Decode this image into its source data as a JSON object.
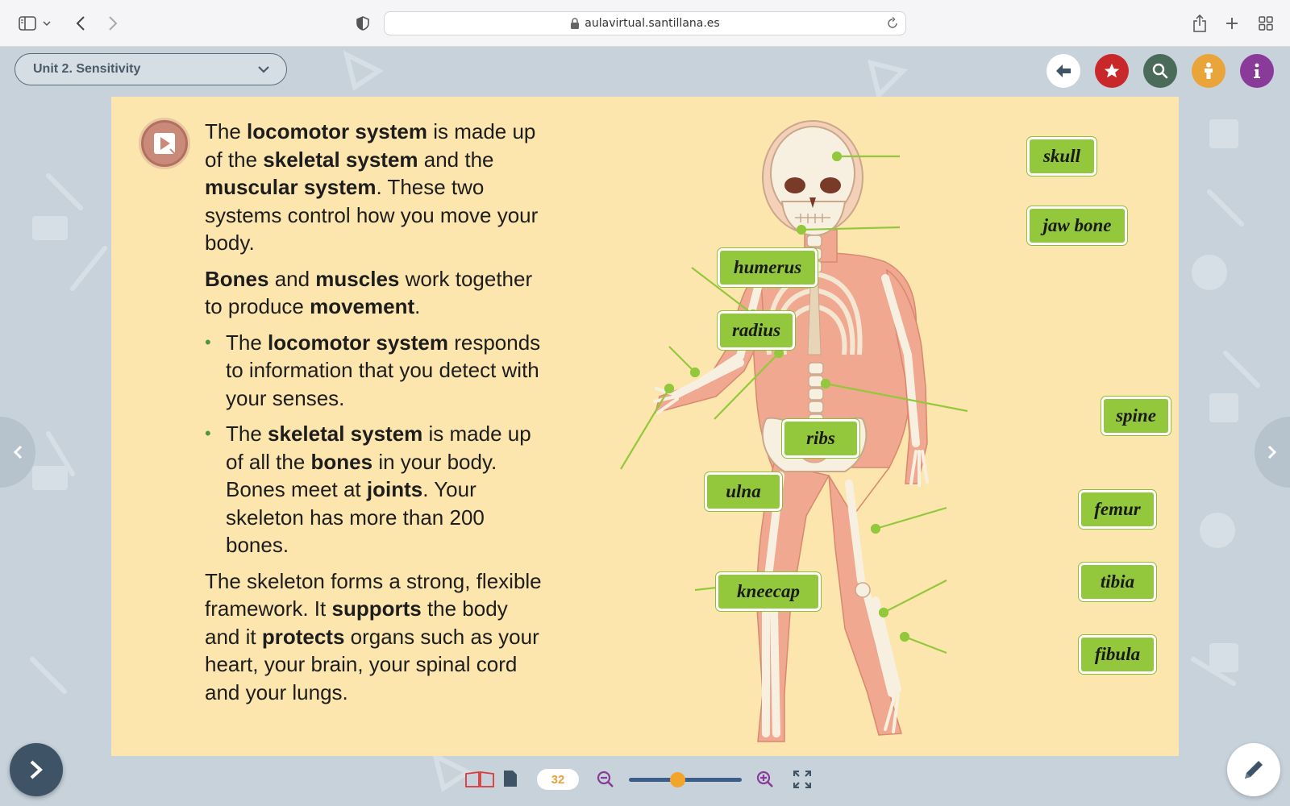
{
  "browser": {
    "url": "aulavirtual.santillana.es",
    "icons": [
      "sidebar-icon",
      "chevron-down-icon",
      "back-icon",
      "forward-icon",
      "shield-icon",
      "lock-icon",
      "reload-icon",
      "share-icon",
      "new-tab-icon",
      "tab-overview-icon"
    ]
  },
  "toolbar": {
    "unit_label": "Unit 2. Sensitivity",
    "buttons": [
      {
        "name": "back-button",
        "icon": "arrow-left-icon",
        "color": "#ffffff"
      },
      {
        "name": "favorites-button",
        "icon": "star-icon",
        "color": "#c8282a"
      },
      {
        "name": "search-button",
        "icon": "search-icon",
        "color": "#4a6a5a"
      },
      {
        "name": "accessibility-button",
        "icon": "person-icon",
        "color": "#e9a43a"
      },
      {
        "name": "info-button",
        "icon": "info-icon",
        "color": "#8a3a98"
      }
    ]
  },
  "content": {
    "p1": {
      "t1": "The ",
      "b1": "locomotor system",
      "t2": " is made up of the ",
      "b2": "skeletal system",
      "t3": " and the ",
      "b3": "muscular system",
      "t4": ". These two systems control how you move your body."
    },
    "p2": {
      "b1": "Bones",
      "t1": " and ",
      "b2": "muscles",
      "t2": " work together to produce ",
      "b3": "movement",
      "t3": "."
    },
    "bullet1": {
      "t1": "The ",
      "b1": "locomotor system",
      "t2": " responds to information that you detect with your senses."
    },
    "bullet2": {
      "t1": "The ",
      "b1": "skeletal system",
      "t2": " is made up of all the ",
      "b2": "bones",
      "t3": " in your body. Bones meet at ",
      "b3": "joints",
      "t4": ". Your skeleton has more than 200 bones."
    },
    "p3": {
      "t1": "The skeleton forms a strong, flexible framework. It ",
      "b1": "supports",
      "t2": " the body and it ",
      "b2": "protects",
      "t3": " organs such as your heart, your brain, your spinal cord and your lungs."
    }
  },
  "labels": {
    "skull": "skull",
    "jaw_bone": "jaw bone",
    "humerus": "humerus",
    "radius": "radius",
    "ribs": "ribs",
    "ulna": "ulna",
    "spine": "spine",
    "femur": "femur",
    "kneecap": "kneecap",
    "tibia": "tibia",
    "fibula": "fibula"
  },
  "viewer": {
    "page_number": "32",
    "zoom_level": 0.43,
    "label_color": "#94c83c",
    "accent_color": "#f2a52a"
  }
}
